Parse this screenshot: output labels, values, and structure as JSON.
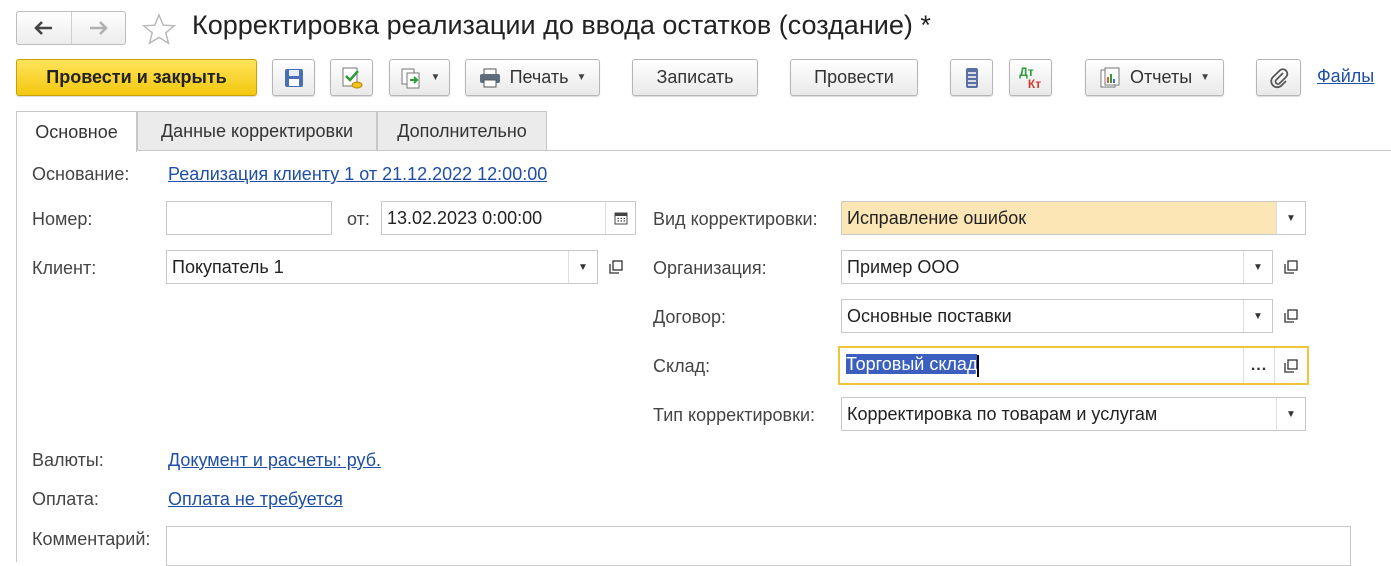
{
  "window": {
    "title": "Корректировка реализации до ввода остатков (создание) *",
    "nav_back_icon": "arrow-left-icon",
    "nav_forward_icon": "arrow-right-icon",
    "favorite_icon": "star-icon"
  },
  "toolbar": {
    "post_close_label": "Провести и закрыть",
    "print_label": "Печать",
    "save_label": "Записать",
    "post_label": "Провести",
    "reports_label": "Отчеты",
    "files_label": "Файлы",
    "dtkt_top": "Дт",
    "dtkt_bottom": "Кт"
  },
  "tabs": [
    {
      "label": "Основное",
      "active": true
    },
    {
      "label": "Данные корректировки",
      "active": false
    },
    {
      "label": "Дополнительно",
      "active": false
    }
  ],
  "form": {
    "basis_label": "Основание:",
    "basis_value": "Реализация клиенту 1 от 21.12.2022 12:00:00",
    "number_label": "Номер:",
    "number_value": "",
    "date_label": "от:",
    "date_value": "13.02.2023  0:00:00",
    "client_label": "Клиент:",
    "client_value": "Покупатель 1",
    "correction_kind_label": "Вид корректировки:",
    "correction_kind_value": "Исправление ошибок",
    "organization_label": "Организация:",
    "organization_value": "Пример ООО",
    "contract_label": "Договор:",
    "contract_value": "Основные поставки",
    "warehouse_label": "Склад:",
    "warehouse_value": "Торговый склад",
    "correction_type_label": "Тип корректировки:",
    "correction_type_value": "Корректировка по товарам и услугам",
    "currency_label": "Валюты:",
    "currency_value": "Документ и расчеты: руб.",
    "payment_label": "Оплата:",
    "payment_value": "Оплата не требуется",
    "comment_label": "Комментарий:",
    "comment_value": ""
  },
  "colors": {
    "primary_button": "#f3c80f",
    "highlight_field": "#fde6b5",
    "focus_border": "#f0c53a",
    "link": "#1f4fa4",
    "selection": "#3a5fbf"
  }
}
